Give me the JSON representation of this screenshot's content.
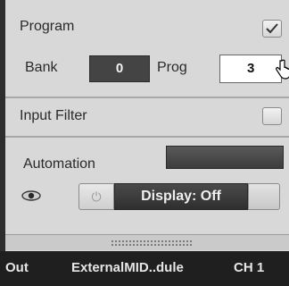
{
  "program": {
    "title": "Program",
    "checked": true,
    "bank_label": "Bank",
    "bank_value": "0",
    "prog_label": "Prog",
    "prog_value": "3"
  },
  "input_filter": {
    "label": "Input Filter",
    "checked": false
  },
  "automation": {
    "label": "Automation",
    "power_icon": "power-icon",
    "display_label": "Display: Off"
  },
  "footer": {
    "port_label": "Out",
    "device_name": "ExternalMID..dule",
    "channel": "CH 1"
  },
  "colors": {
    "panel_bg": "#d8d8d8",
    "dark_field": "#444444",
    "footer_bg": "#1f1f1f"
  }
}
